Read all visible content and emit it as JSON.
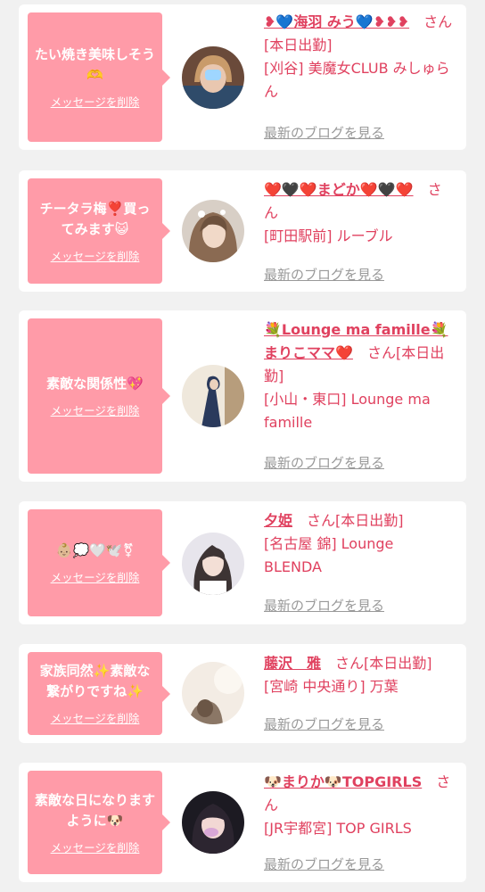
{
  "items": [
    {
      "message": "たい焼き美味しそう🫶",
      "delete_label": "メッセージを削除",
      "name": "❥💙海羽 みう💙❥❥❥",
      "san": "さん",
      "status": "[本日出勤]",
      "shop": "[刈谷] 美魔女CLUB みしゅらん",
      "blog_link": "最新のブログを見る"
    },
    {
      "message": "チータラ梅❣️買ってみます😺",
      "delete_label": "メッセージを削除",
      "name": "❤️🖤❤️まどか❤️🖤❤️",
      "san": "さん",
      "status": "",
      "shop": "[町田駅前] ルーブル",
      "blog_link": "最新のブログを見る"
    },
    {
      "message": "素敵な関係性💖",
      "delete_label": "メッセージを削除",
      "name": "💐Lounge ma famille💐まりこママ❤️",
      "san": "さん",
      "status": "[本日出勤]",
      "shop": "[小山・東口] Lounge ma famille",
      "blog_link": "最新のブログを見る"
    },
    {
      "message": "👶🏼💭🤍🕊️⚧",
      "delete_label": "メッセージを削除",
      "name": "夕姫",
      "san": "さん",
      "status": "[本日出勤]",
      "shop": "[名古屋 錦] Lounge BLENDA",
      "blog_link": "最新のブログを見る"
    },
    {
      "message": "家族同然✨素敵な繋がりですね✨",
      "delete_label": "メッセージを削除",
      "name": "藤沢　雅",
      "san": "さん",
      "status": "[本日出勤]",
      "shop": "[宮崎 中央通り] 万葉",
      "blog_link": "最新のブログを見る"
    },
    {
      "message": "素敵な日になりますように🐶",
      "delete_label": "メッセージを削除",
      "name": "🐶まりか🐶TOPGIRLS",
      "san": "さん",
      "status": "",
      "shop": "[JR宇都宮] TOP GIRLS",
      "blog_link": "最新のブログを見る"
    }
  ],
  "colors": {
    "accent": "#e0415f",
    "bubble": "#ff9ba8",
    "background": "#f1f1f1",
    "link_gray": "#999999"
  }
}
